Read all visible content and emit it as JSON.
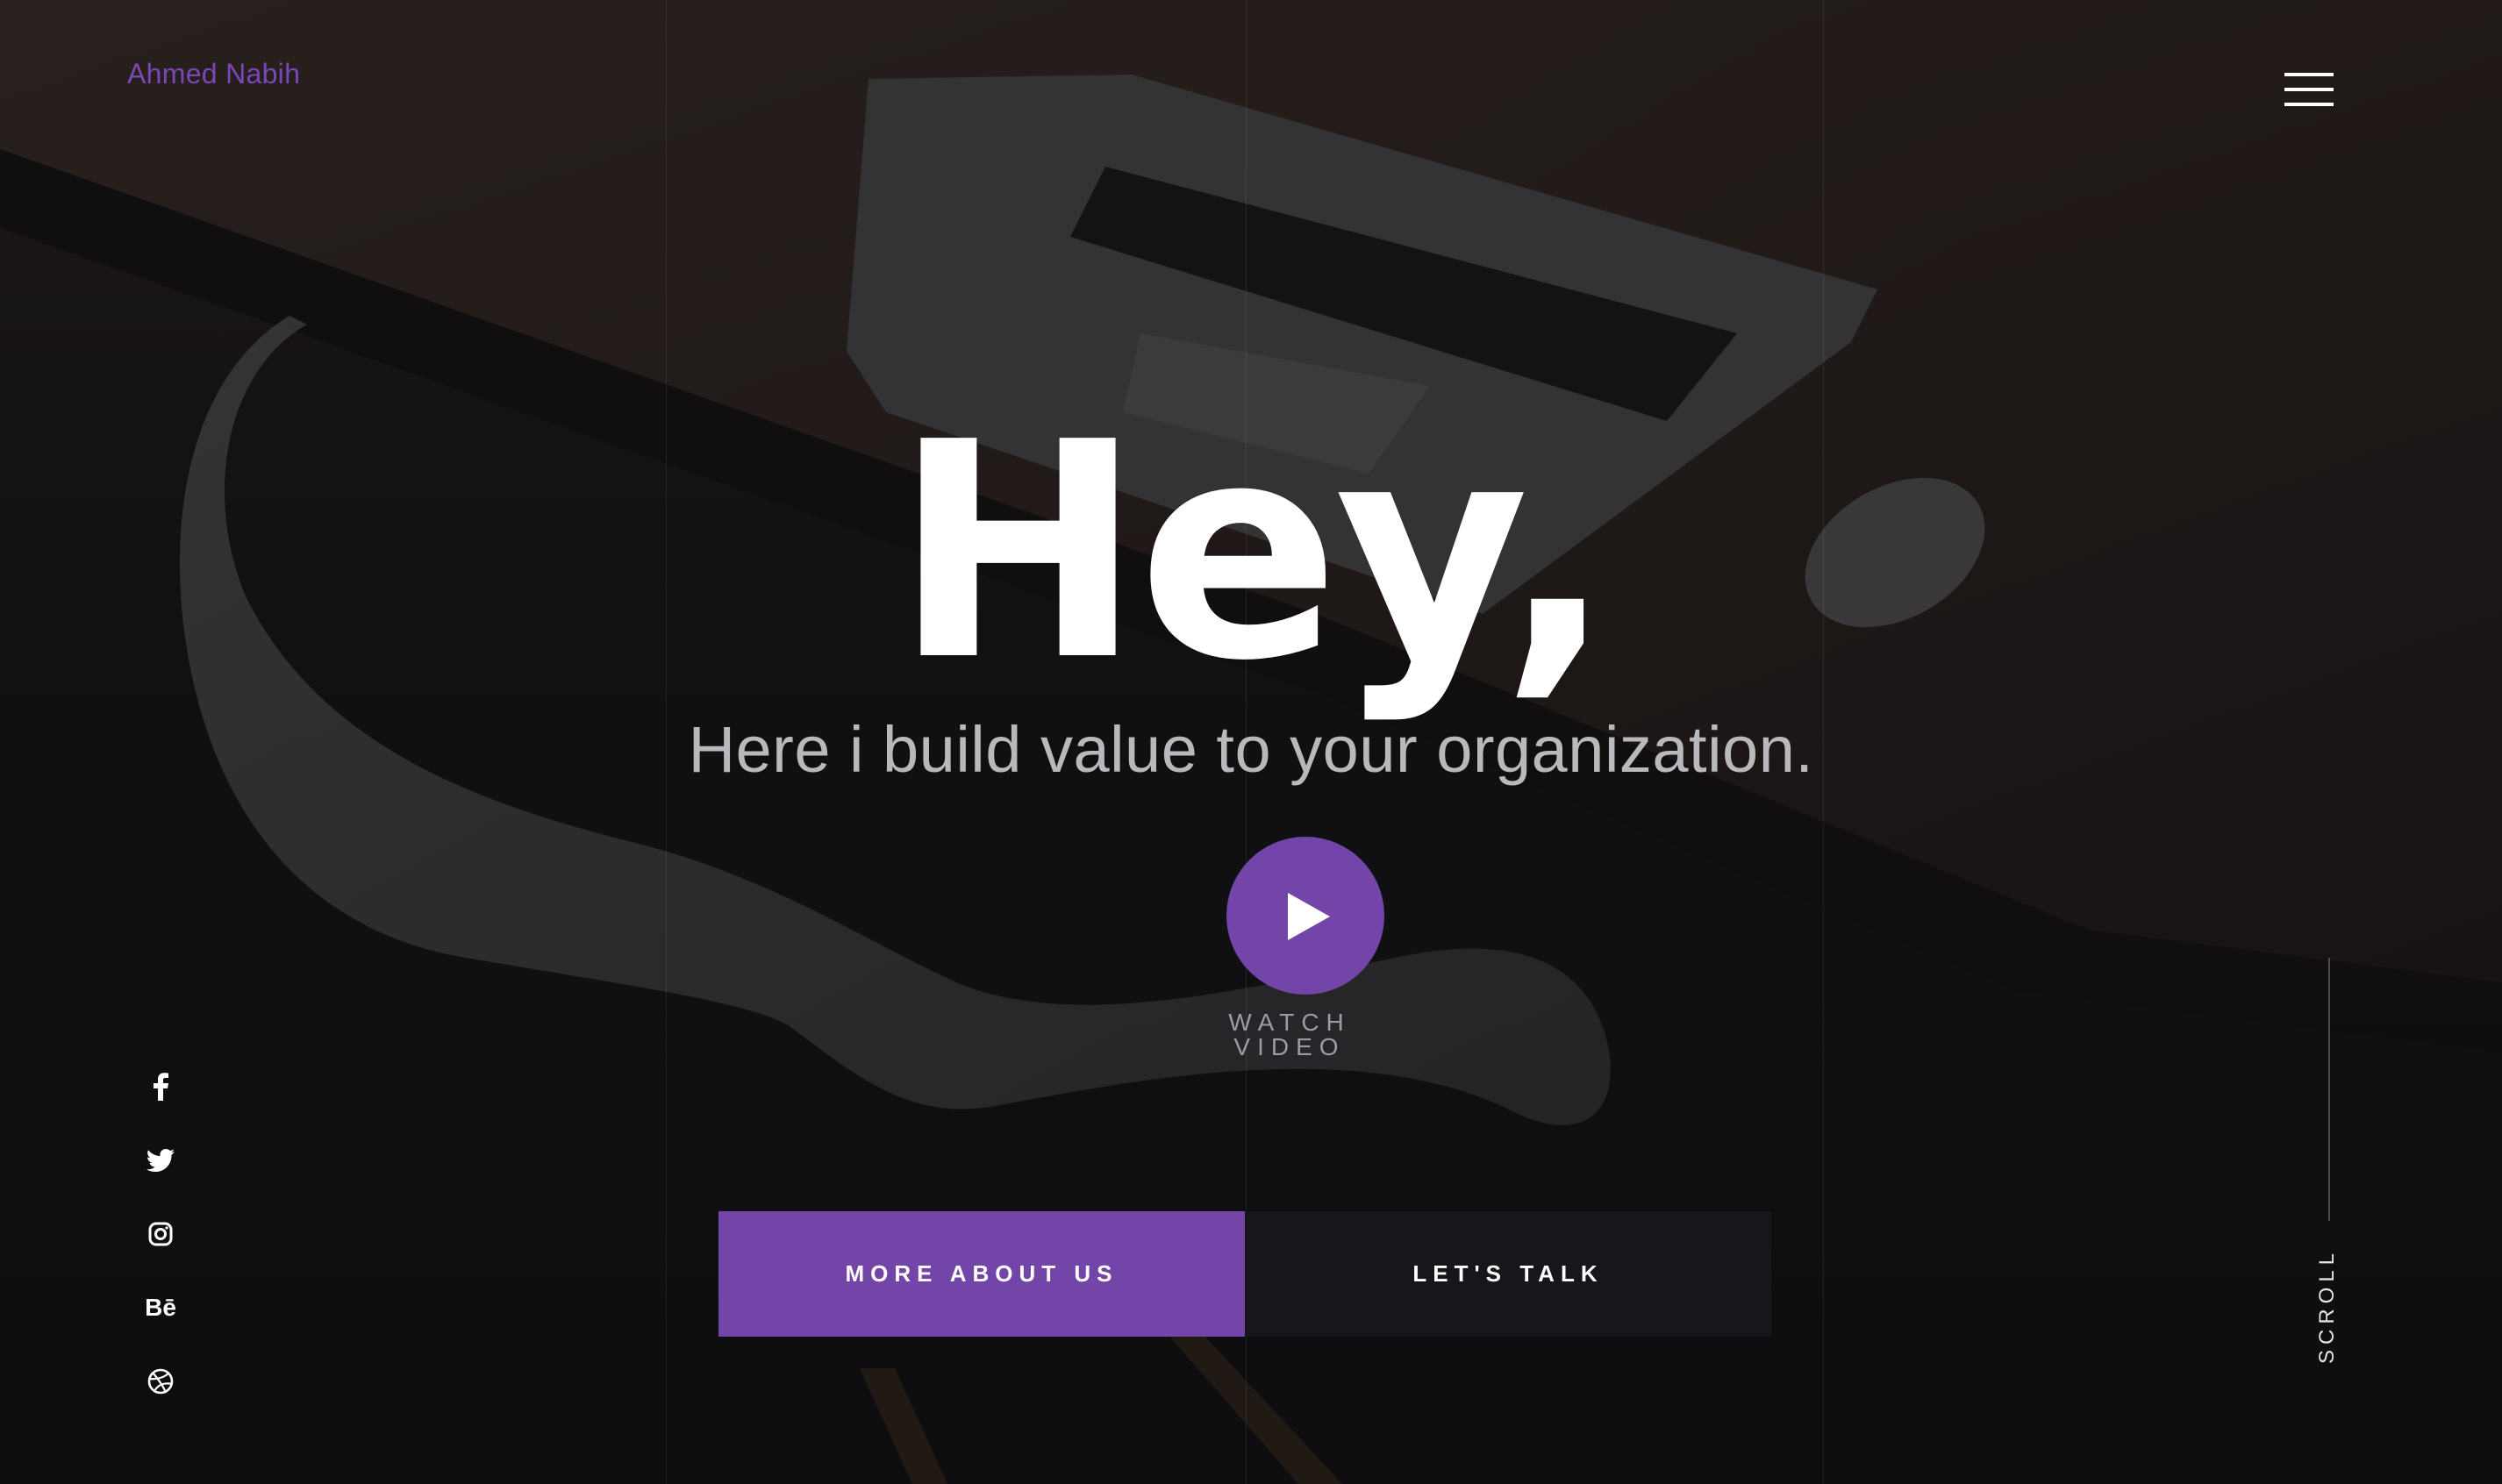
{
  "brand": {
    "name": "Ahmed Nabih"
  },
  "hero": {
    "headline": "Hey,",
    "subtitle": "Here i build value to your organization.",
    "watch_video": {
      "line1": "WATCH",
      "line2": "VIDEO"
    }
  },
  "buttons": {
    "more_about": "MORE ABOUT US",
    "lets_talk": "LET'S TALK"
  },
  "social": {
    "icons": [
      "facebook-icon",
      "twitter-icon",
      "instagram-icon",
      "behance-icon",
      "dribbble-icon"
    ],
    "behance_text": "Bē"
  },
  "scroll": {
    "label": "SCROLL"
  },
  "colors": {
    "accent": "#7445a8",
    "brand_text": "#7a46b8",
    "background": "#131314",
    "dark_button": "#16161b"
  }
}
